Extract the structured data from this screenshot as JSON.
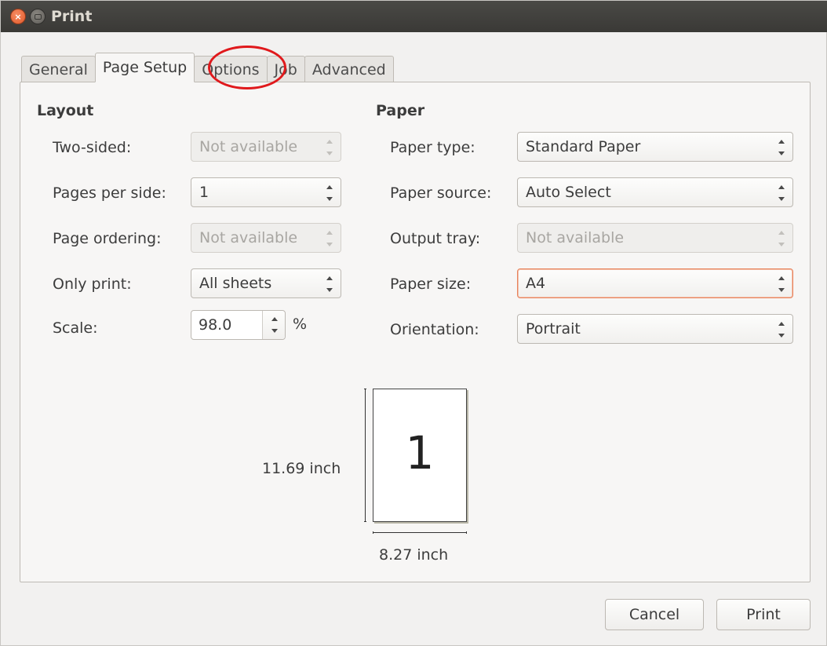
{
  "window": {
    "title": "Print"
  },
  "tabs": [
    {
      "label": "General",
      "active": false
    },
    {
      "label": "Page Setup",
      "active": true
    },
    {
      "label": "Options",
      "active": false,
      "highlighted": true
    },
    {
      "label": "Job",
      "active": false
    },
    {
      "label": "Advanced",
      "active": false
    }
  ],
  "layout": {
    "title": "Layout",
    "two_sided": {
      "label": "Two-sided:",
      "value": "Not available",
      "enabled": false
    },
    "pages_per_side": {
      "label": "Pages per side:",
      "value": "1",
      "enabled": true
    },
    "page_ordering": {
      "label": "Page ordering:",
      "value": "Not available",
      "enabled": false
    },
    "only_print": {
      "label": "Only print:",
      "value": "All sheets",
      "enabled": true
    },
    "scale": {
      "label": "Scale:",
      "value": "98.0",
      "unit": "%"
    }
  },
  "paper": {
    "title": "Paper",
    "paper_type": {
      "label": "Paper type:",
      "value": "Standard Paper",
      "enabled": true
    },
    "paper_source": {
      "label": "Paper source:",
      "value": "Auto Select",
      "enabled": true
    },
    "output_tray": {
      "label": "Output tray:",
      "value": "Not available",
      "enabled": false
    },
    "paper_size": {
      "label": "Paper size:",
      "value": "A4",
      "enabled": true,
      "focused": true
    },
    "orientation": {
      "label": "Orientation:",
      "value": "Portrait",
      "enabled": true
    }
  },
  "preview": {
    "page_number": "1",
    "height_label": "11.69 inch",
    "width_label": "8.27 inch"
  },
  "buttons": {
    "cancel": "Cancel",
    "print": "Print"
  },
  "colors": {
    "highlight_circle": "#e0191c",
    "focus_border": "#e8825c",
    "close_button": "#e25a2b"
  }
}
